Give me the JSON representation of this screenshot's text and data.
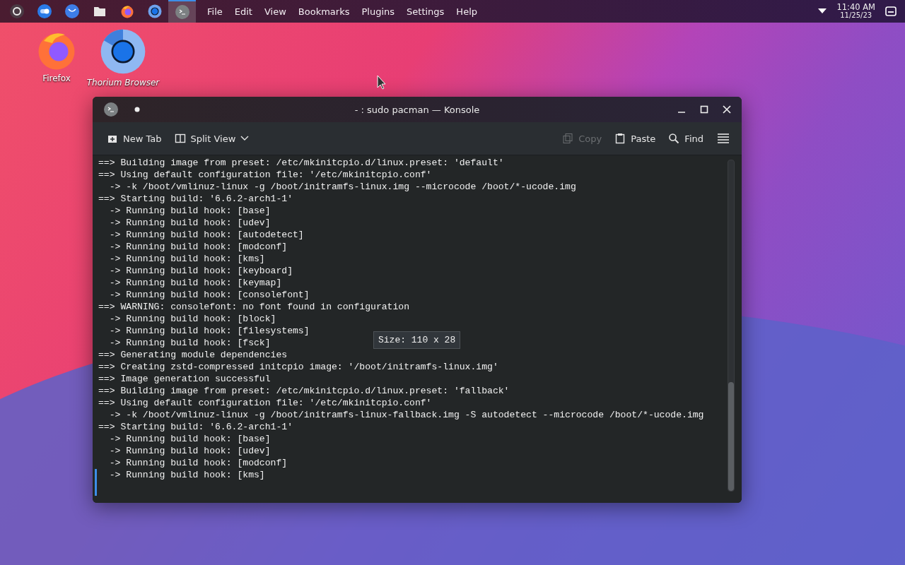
{
  "taskbar": {
    "launchers": [
      {
        "kind": "menu",
        "selected": false
      },
      {
        "kind": "toggle",
        "selected": false
      },
      {
        "kind": "mail",
        "selected": false
      },
      {
        "kind": "folder",
        "selected": false
      },
      {
        "kind": "firefox",
        "selected": false
      },
      {
        "kind": "chromium",
        "selected": false
      },
      {
        "kind": "terminal",
        "selected": true
      }
    ],
    "menu": [
      "File",
      "Edit",
      "View",
      "Bookmarks",
      "Plugins",
      "Settings",
      "Help"
    ],
    "clock": {
      "time": "11:40 AM",
      "date": "11/25/23"
    }
  },
  "desktop_icons": [
    {
      "kind": "firefox",
      "label": "Firefox"
    },
    {
      "kind": "chromium",
      "label": "Thorium Browser"
    }
  ],
  "window": {
    "title": "- : sudo pacman — Konsole",
    "toolbar": [
      {
        "kind": "new-tab",
        "label": "New Tab",
        "disabled": false
      },
      {
        "kind": "split",
        "label": "Split View",
        "disabled": false
      },
      {
        "kind": "copy",
        "label": "Copy",
        "disabled": true
      },
      {
        "kind": "paste",
        "label": "Paste",
        "disabled": false
      },
      {
        "kind": "find",
        "label": "Find",
        "disabled": false
      }
    ],
    "terminal_lines": [
      "==> Building image from preset: /etc/mkinitcpio.d/linux.preset: 'default'",
      "==> Using default configuration file: '/etc/mkinitcpio.conf'",
      "  -> -k /boot/vmlinuz-linux -g /boot/initramfs-linux.img --microcode /boot/*-ucode.img",
      "==> Starting build: '6.6.2-arch1-1'",
      "  -> Running build hook: [base]",
      "  -> Running build hook: [udev]",
      "  -> Running build hook: [autodetect]",
      "  -> Running build hook: [modconf]",
      "  -> Running build hook: [kms]",
      "  -> Running build hook: [keyboard]",
      "  -> Running build hook: [keymap]",
      "  -> Running build hook: [consolefont]",
      "==> WARNING: consolefont: no font found in configuration",
      "  -> Running build hook: [block]",
      "  -> Running build hook: [filesystems]",
      "  -> Running build hook: [fsck]",
      "==> Generating module dependencies",
      "==> Creating zstd-compressed initcpio image: '/boot/initramfs-linux.img'",
      "==> Image generation successful",
      "==> Building image from preset: /etc/mkinitcpio.d/linux.preset: 'fallback'",
      "==> Using default configuration file: '/etc/mkinitcpio.conf'",
      "  -> -k /boot/vmlinuz-linux -g /boot/initramfs-linux-fallback.img -S autodetect --microcode /boot/*-ucode.img",
      "==> Starting build: '6.6.2-arch1-1'",
      "  -> Running build hook: [base]",
      "  -> Running build hook: [udev]",
      "  -> Running build hook: [modconf]",
      "  -> Running build hook: [kms]"
    ],
    "size_tooltip": "Size: 110 x 28"
  }
}
